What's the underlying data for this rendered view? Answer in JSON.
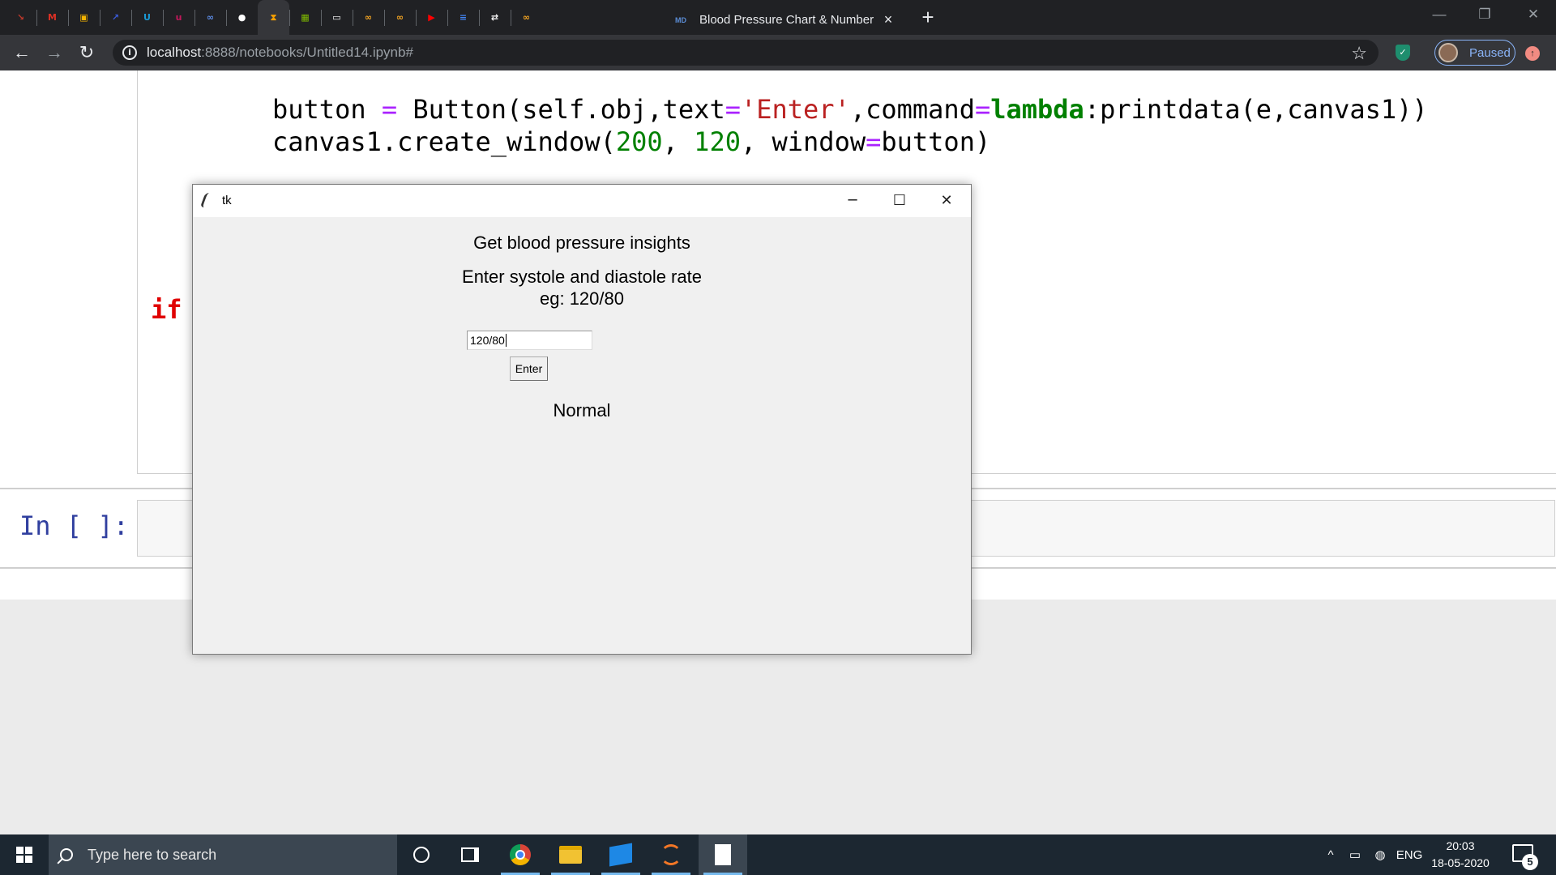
{
  "browser": {
    "active_tab_title": "Blood Pressure Chart & Number",
    "url_host": "localhost",
    "url_path": ":8888/notebooks/Untitled14.ipynb#",
    "profile_status": "Paused",
    "pinned_tabs": [
      {
        "name": "pinned-tab-1",
        "glyph": "↘",
        "color": "#c0392b"
      },
      {
        "name": "pinned-tab-gmail",
        "glyph": "M",
        "color": "#d93025"
      },
      {
        "name": "pinned-tab-3",
        "glyph": "▣",
        "color": "#f4b400"
      },
      {
        "name": "pinned-tab-4",
        "glyph": "↗",
        "color": "#3b5bdb"
      },
      {
        "name": "pinned-tab-5",
        "glyph": "U",
        "color": "#1a9ad6"
      },
      {
        "name": "pinned-tab-6",
        "glyph": "u",
        "color": "#c2185b"
      },
      {
        "name": "pinned-tab-7",
        "glyph": "∞",
        "color": "#5e8ee8"
      },
      {
        "name": "pinned-tab-github",
        "glyph": "●",
        "color": "#ffffff"
      },
      {
        "name": "pinned-tab-9",
        "glyph": "⧗",
        "color": "#f59f00"
      },
      {
        "name": "pinned-tab-microsoft",
        "glyph": "▦",
        "color": "#7fba00"
      },
      {
        "name": "pinned-tab-11",
        "glyph": "▭",
        "color": "#ffffff"
      },
      {
        "name": "pinned-tab-12",
        "glyph": "∞",
        "color": "#f5a623"
      },
      {
        "name": "pinned-tab-13",
        "glyph": "∞",
        "color": "#f5a623"
      },
      {
        "name": "pinned-tab-youtube",
        "glyph": "▶",
        "color": "#ff0000"
      },
      {
        "name": "pinned-tab-15",
        "glyph": "≡",
        "color": "#4285f4"
      },
      {
        "name": "pinned-tab-16",
        "glyph": "⇄",
        "color": "#ffffff"
      },
      {
        "name": "pinned-tab-17",
        "glyph": "∞",
        "color": "#f5a623"
      }
    ]
  },
  "notebook": {
    "prompt_empty": "In [ ]:"
  },
  "tk": {
    "window_title": "tk",
    "heading": "Get blood pressure insights",
    "instruction": "Enter systole and diastole rate",
    "example": "eg: 120/80",
    "entry_value": "120/80",
    "button_label": "Enter",
    "result": "Normal"
  },
  "taskbar": {
    "search_placeholder": "Type here to search",
    "language": "ENG",
    "time": "20:03",
    "date": "18-05-2020",
    "notification_count": "5"
  }
}
